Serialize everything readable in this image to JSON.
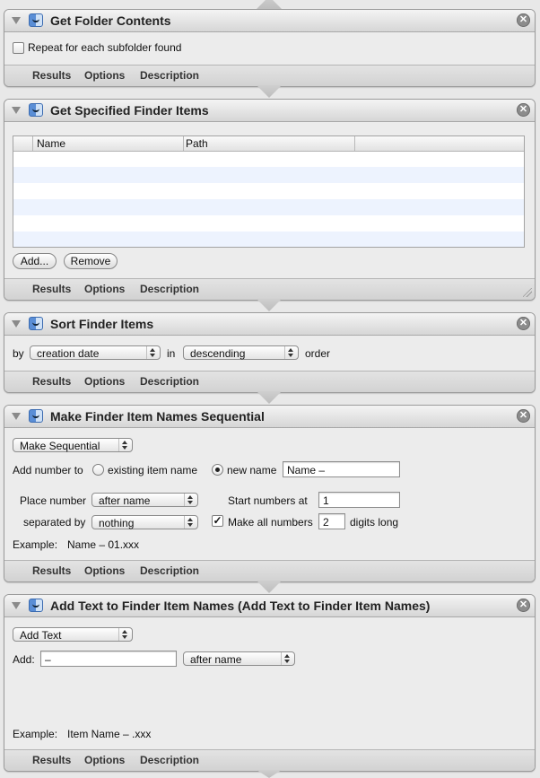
{
  "footer_tabs": [
    "Results",
    "Options",
    "Description"
  ],
  "actions": {
    "get_folder_contents": {
      "title": "Get Folder Contents",
      "repeat_label": "Repeat for each subfolder found",
      "repeat_checked": false
    },
    "get_specified_finder_items": {
      "title": "Get Specified Finder Items",
      "columns": [
        "Name",
        "Path"
      ],
      "add_label": "Add...",
      "remove_label": "Remove"
    },
    "sort_finder_items": {
      "title": "Sort Finder Items",
      "by_label": "by",
      "sort_by": "creation date",
      "in_label": "in",
      "order_value": "descending",
      "order_label": "order"
    },
    "make_sequential": {
      "title": "Make Finder Item Names Sequential",
      "mode": "Make Sequential",
      "add_number_to_label": "Add number to",
      "existing_item_name_label": "existing item name",
      "new_name_label": "new name",
      "new_name_value": "Name –",
      "place_number_label": "Place number",
      "place_number_value": "after name",
      "start_numbers_at_label": "Start numbers at",
      "start_numbers_value": "1",
      "separated_by_label": "separated by",
      "separated_by_value": "nothing",
      "make_all_numbers_label": "Make all numbers",
      "make_all_numbers_checked": true,
      "digits_value": "2",
      "digits_long_label": "digits long",
      "example_label": "Example:",
      "example_value": "Name – 01.xxx"
    },
    "add_text": {
      "title": "Add Text to Finder Item Names (Add Text to Finder Item Names)",
      "mode": "Add Text",
      "add_label": "Add:",
      "add_value": "–",
      "position_value": "after name",
      "example_label": "Example:",
      "example_value": "Item Name – .xxx"
    }
  }
}
